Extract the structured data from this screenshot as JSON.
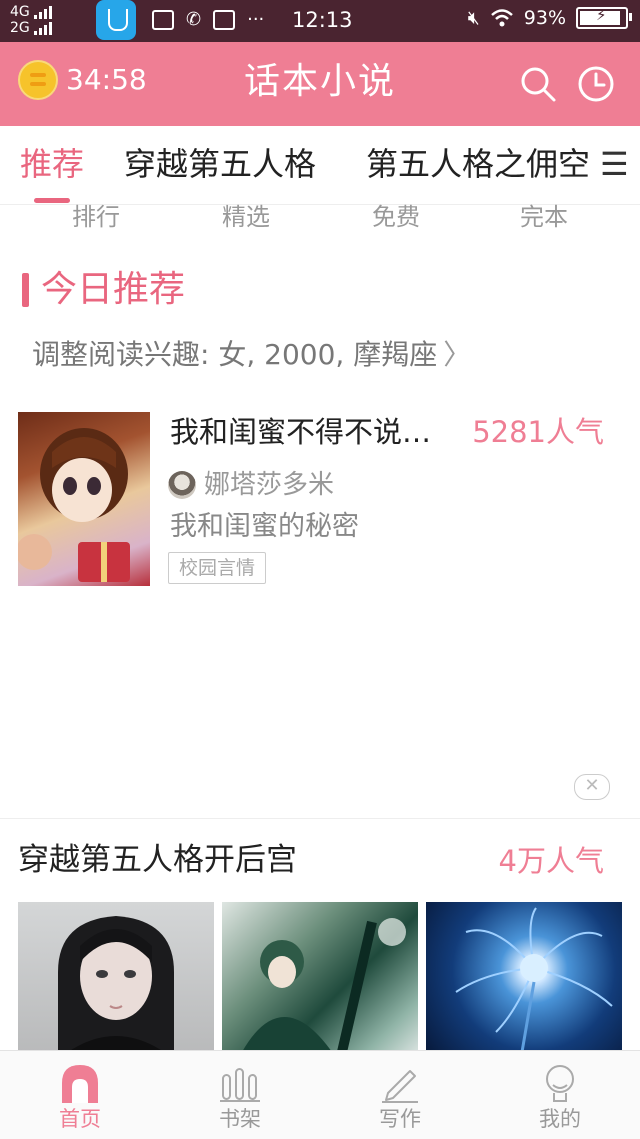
{
  "status_bar": {
    "network_top": "4G",
    "network_bottom": "2G",
    "time": "12:13",
    "battery": "93%"
  },
  "header": {
    "timer": "34:58",
    "title": "话本小说",
    "accent_color": "#ef7e94"
  },
  "category_tabs": [
    {
      "label": "推荐",
      "active": true
    },
    {
      "label": "穿越第五人格",
      "active": false
    },
    {
      "label": "第五人格之佣空",
      "active": false
    }
  ],
  "sub_tabs": [
    "排行",
    "精选",
    "免费",
    "完本"
  ],
  "today": {
    "title": "今日推荐",
    "interest": "调整阅读兴趣: 女, 2000, 摩羯座",
    "book": {
      "title": "我和闺蜜不得不说…",
      "popularity": "5281人气",
      "author": "娜塔莎多米",
      "description": "我和闺蜜的秘密",
      "tag": "校园言情"
    }
  },
  "section2": {
    "title": "穿越第五人格开后宫",
    "popularity": "4万人气"
  },
  "bottom_nav": [
    {
      "label": "首页",
      "icon": "home-icon",
      "active": true
    },
    {
      "label": "书架",
      "icon": "bookshelf-icon",
      "active": false
    },
    {
      "label": "写作",
      "icon": "pen-icon",
      "active": false
    },
    {
      "label": "我的",
      "icon": "profile-icon",
      "active": false
    }
  ]
}
